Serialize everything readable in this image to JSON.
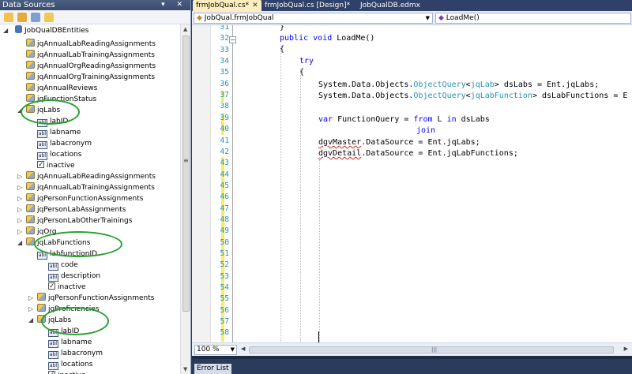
{
  "data_sources": {
    "title": "Data Sources",
    "title_buttons": "▾ ✕",
    "root": "JobQualDBEntities",
    "nodes": [
      {
        "label": "jqAnnualLabReadingAssignments",
        "icon": "entity-icon"
      },
      {
        "label": "jqAnnualLabTrainingAssignments",
        "icon": "entity-icon"
      },
      {
        "label": "jqAnnualOrgReadingAssignments",
        "icon": "entity-icon"
      },
      {
        "label": "jqAnnualOrgTrainingAssignments",
        "icon": "entity-icon"
      },
      {
        "label": "jqAnnualReviews",
        "icon": "entity-icon"
      },
      {
        "label": "jqFunctionStatus",
        "icon": "entity-icon"
      },
      {
        "label": "jqLabs",
        "icon": "entity-icon"
      },
      {
        "label": "labID",
        "icon": "field-icon"
      },
      {
        "label": "labname",
        "icon": "field-icon"
      },
      {
        "label": "labacronym",
        "icon": "field-icon"
      },
      {
        "label": "locations",
        "icon": "field-icon"
      },
      {
        "label": "inactive",
        "icon": "checkbox-icon"
      },
      {
        "label": "jqAnnualLabReadingAssignments",
        "icon": "entity-icon"
      },
      {
        "label": "jqAnnualLabTrainingAssignments",
        "icon": "entity-icon"
      },
      {
        "label": "jqPersonFunctionAssignments",
        "icon": "entity-icon"
      },
      {
        "label": "jqPersonLabAssignments",
        "icon": "entity-icon"
      },
      {
        "label": "jqPersonLabOtherTrainings",
        "icon": "entity-icon"
      },
      {
        "label": "jqOrg",
        "icon": "entity-icon"
      },
      {
        "label": "jqLabFunctions",
        "icon": "entity-icon"
      },
      {
        "label": "labfunctionID",
        "icon": "field-icon"
      },
      {
        "label": "code",
        "icon": "field-icon"
      },
      {
        "label": "description",
        "icon": "field-icon"
      },
      {
        "label": "inactive",
        "icon": "checkbox-icon"
      },
      {
        "label": "jqPersonFunctionAssignments",
        "icon": "entity-icon"
      },
      {
        "label": "jqProficiencies",
        "icon": "entity-icon"
      },
      {
        "label": "jqLabs",
        "icon": "entity-icon"
      },
      {
        "label": "labID",
        "icon": "field-icon"
      },
      {
        "label": "labname",
        "icon": "field-icon"
      },
      {
        "label": "labacronym",
        "icon": "field-icon"
      },
      {
        "label": "locations",
        "icon": "field-icon"
      },
      {
        "label": "inactive",
        "icon": "checkbox-icon"
      }
    ]
  },
  "tabs": [
    {
      "label": "frmJobQual.cs*",
      "close": "✕"
    },
    {
      "label": "frmJobQual.cs [Design]*"
    },
    {
      "label": "JobQualDB.edmx"
    }
  ],
  "nav": {
    "class_dropdown": "JobQual.frmJobQual",
    "member_dropdown": "LoadMe()"
  },
  "editor": {
    "line_numbers": [
      "31",
      "32",
      "33",
      "34",
      "35",
      "36",
      "37",
      "38",
      "39",
      "40",
      "41",
      "42",
      "43",
      "44",
      "45",
      "46",
      "47",
      "48",
      "49",
      "50",
      "51",
      "52",
      "53",
      "54",
      "55",
      "56",
      "57",
      "58"
    ],
    "lines": {
      "l31": "}",
      "l32_kw": "public void",
      "l32_rest": " LoadMe()",
      "l33": "{",
      "l34": "try",
      "l35": "{",
      "l36_a": "System.Data.Objects.",
      "l36_b": "ObjectQuery",
      "l36_c": "<",
      "l36_d": "jqLab",
      "l36_e": "> dsLabs = Ent.jqLabs;",
      "l37_a": "System.Data.Objects.",
      "l37_b": "ObjectQuery",
      "l37_c": "<",
      "l37_d": "jqLabFunction",
      "l37_e": "> dsLabFunctions = E",
      "l39_kw": "var",
      "l39_a": " FunctionQuery = ",
      "l39_from": "from",
      "l39_b": " L ",
      "l39_in": "in",
      "l39_c": " dsLabs",
      "l40": "join",
      "l41_sq": "dgvMaster",
      "l41_rest": ".DataSource = Ent.jqLabs;",
      "l42_sq": "dgvDetail",
      "l42_rest": ".DataSource = Ent.jqLabFunctions;"
    }
  },
  "status": {
    "zoom": "100 %",
    "error_list": "Error List"
  },
  "colors": {
    "annotation_circle": "#27a12d",
    "keyword": "#0000ff",
    "type": "#2b91af",
    "modified_margin": "#f6ec6e"
  }
}
